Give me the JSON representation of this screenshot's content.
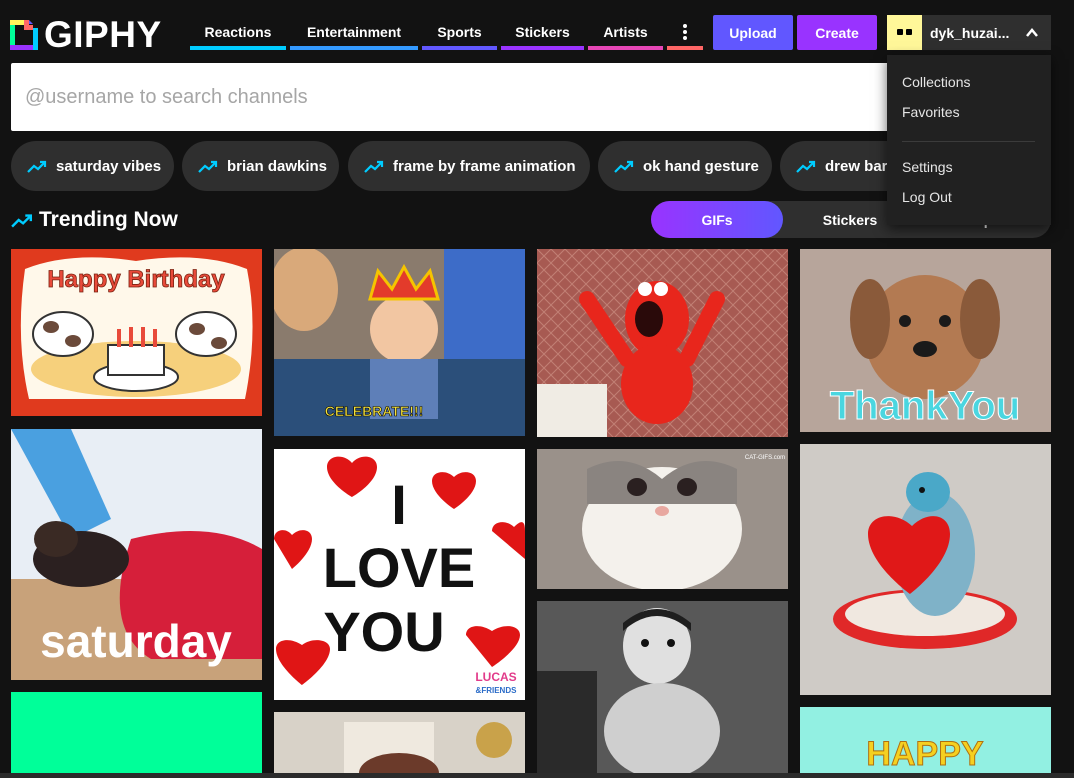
{
  "brand": {
    "name": "GIPHY"
  },
  "nav": [
    {
      "label": "Reactions",
      "color": "#00ccff"
    },
    {
      "label": "Entertainment",
      "color": "#3399ff"
    },
    {
      "label": "Sports",
      "color": "#6157ff"
    },
    {
      "label": "Stickers",
      "color": "#9933ff"
    },
    {
      "label": "Artists",
      "color": "#e646b6"
    }
  ],
  "more_icon": "more-vertical-icon",
  "buttons": {
    "upload": "Upload",
    "create": "Create"
  },
  "user": {
    "name": "dyk_huzai...",
    "menu_icon": "chevron-up-icon"
  },
  "user_menu": {
    "collections": "Collections",
    "favorites": "Favorites",
    "settings": "Settings",
    "logout": "Log Out"
  },
  "search": {
    "placeholder": "@username to search channels"
  },
  "trending_searches": [
    "saturday vibes",
    "brian dawkins",
    "frame by frame animation",
    "ok hand gesture",
    "drew barr"
  ],
  "trending": {
    "title": "Trending Now",
    "tabs": {
      "gifs": "GIFs",
      "stickers": "Stickers",
      "clips": "Clips"
    }
  },
  "gif_text": {
    "happy_birthday": "Happy Birthday",
    "celebrate": "CELEBRATE!!!",
    "thank_you": "ThankYou",
    "saturday": "saturday",
    "i_love_you_1": "I",
    "i_love_you_2": "LOVE",
    "i_love_you_3": "YOU",
    "lucas": "LUCAS",
    "lucas_friends": "&FRIENDS",
    "cat_gifs": "CAT-GIFS.com",
    "happy": "HAPPY"
  },
  "colors": {
    "background": "#121212",
    "upload_button": "#6157ff",
    "create_button": "#9933ff",
    "avatar_bg": "#fff799",
    "trend_arrow": "#00ccff"
  }
}
